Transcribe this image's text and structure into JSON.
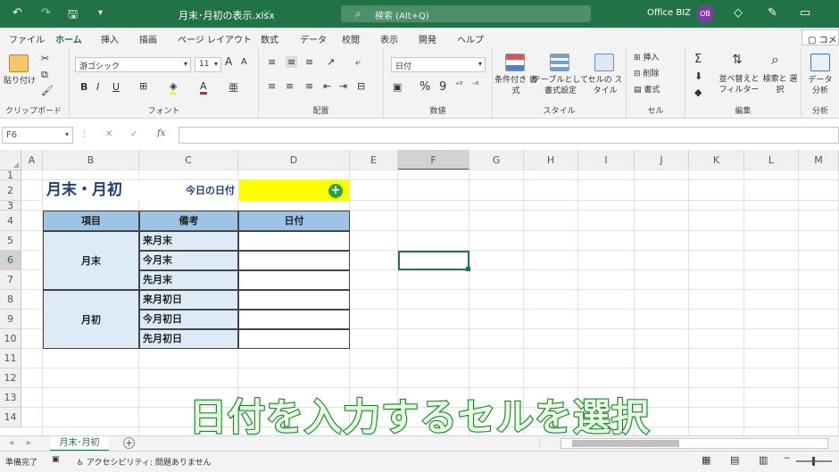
{
  "titlebar": {
    "filename": "月末･月初の表示.xlsx",
    "search_placeholder": "検索 (Alt+Q)",
    "user": "Office BIZ",
    "avatar": "OB",
    "accent": "#217346"
  },
  "ribbon_tabs": [
    "ファイル",
    "ホーム",
    "挿入",
    "描画",
    "ページ レイアウト",
    "数式",
    "データ",
    "校閲",
    "表示",
    "開発",
    "ヘルプ"
  ],
  "comment_label": "コメ",
  "ribbon": {
    "clipboard": {
      "paste": "貼り付け",
      "label": "クリップボード"
    },
    "font": {
      "name": "游ゴシック",
      "size": "11",
      "bold": "B",
      "italic": "I",
      "underline": "U",
      "label": "フォント",
      "grow": "A",
      "shrink": "A"
    },
    "align": {
      "label": "配置"
    },
    "number": {
      "format": "日付",
      "label": "数値",
      "percent": "%",
      "comma": "9"
    },
    "style": {
      "cond": "条件付き 書式",
      "table": "テーブルとして 書式設定",
      "cellstyle": "セルの スタイル",
      "label": "スタイル"
    },
    "cells": {
      "insert": "挿入",
      "delete": "削除",
      "format": "書式",
      "label": "セル"
    },
    "edit": {
      "sum": "Σ",
      "sort": "並べ替えと フィルター",
      "find": "検索と 選択",
      "label": "編集"
    },
    "analysis": {
      "data": "データ 分析",
      "label": "分析"
    }
  },
  "formula_bar": {
    "name_box": "F6",
    "fx": "fx",
    "cancel": "✕",
    "enter": "✓"
  },
  "columns": [
    "A",
    "B",
    "C",
    "D",
    "E",
    "F",
    "G",
    "H",
    "I",
    "J",
    "K",
    "L",
    "M"
  ],
  "rows": [
    "1",
    "2",
    "3",
    "4",
    "5",
    "6",
    "7",
    "8",
    "9",
    "10",
    "11",
    "12",
    "13",
    "14"
  ],
  "sheet": {
    "title": "月末・月初",
    "today_label": "今日の日付",
    "headers": {
      "item": "項目",
      "note": "備考",
      "date": "日付"
    },
    "group_end": "月末",
    "group_start": "月初",
    "notes": [
      "来月末",
      "今月末",
      "先月末",
      "来月初日",
      "今月初日",
      "先月初日"
    ]
  },
  "sheet_tab": "月末･月初",
  "add_sheet": "+",
  "status": {
    "ready": "準備完了",
    "accessibility": "アクセシビリティ: 問題ありません"
  },
  "caption": "日付を入力するセルを選択"
}
